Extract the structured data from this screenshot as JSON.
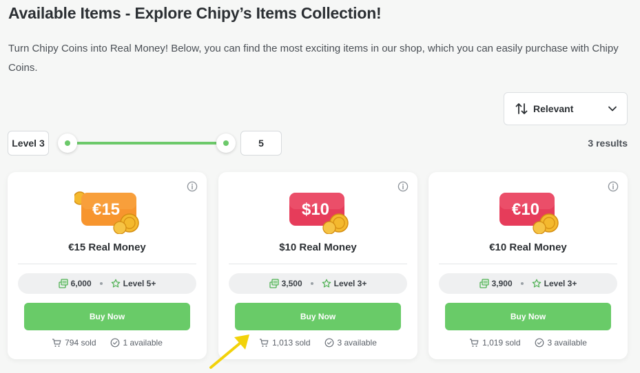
{
  "page": {
    "title": "Available Items - Explore Chipy’s Items Collection!",
    "description": "Turn Chipy Coins into Real Money! Below, you can find the most exciting items in our shop, which you can easily purchase with Chipy Coins."
  },
  "sort": {
    "label": "Relevant",
    "icon": "sort-arrows-icon"
  },
  "filter": {
    "level_min_label": "Level 3",
    "level_max_value": "5",
    "results": "3 results",
    "accent": "#6cc96a"
  },
  "items": [
    {
      "badge": "€15",
      "badge_color": "#f7952e",
      "name": "€15 Real Money",
      "price": "6,000",
      "level": "Level 5+",
      "buy": "Buy Now",
      "sold": "794 sold",
      "available": "1 available"
    },
    {
      "badge": "$10",
      "badge_color": "#e63c5a",
      "name": "$10 Real Money",
      "price": "3,500",
      "level": "Level 3+",
      "buy": "Buy Now",
      "sold": "1,013 sold",
      "available": "3 available"
    },
    {
      "badge": "€10",
      "badge_color": "#e63c5a",
      "name": "€10 Real Money",
      "price": "3,900",
      "level": "Level 3+",
      "buy": "Buy Now",
      "sold": "1,019 sold",
      "available": "3 available"
    }
  ],
  "colors": {
    "buy_button": "#69cb68",
    "background": "#f6f7f6",
    "annotation_arrow": "#f2d20a"
  }
}
